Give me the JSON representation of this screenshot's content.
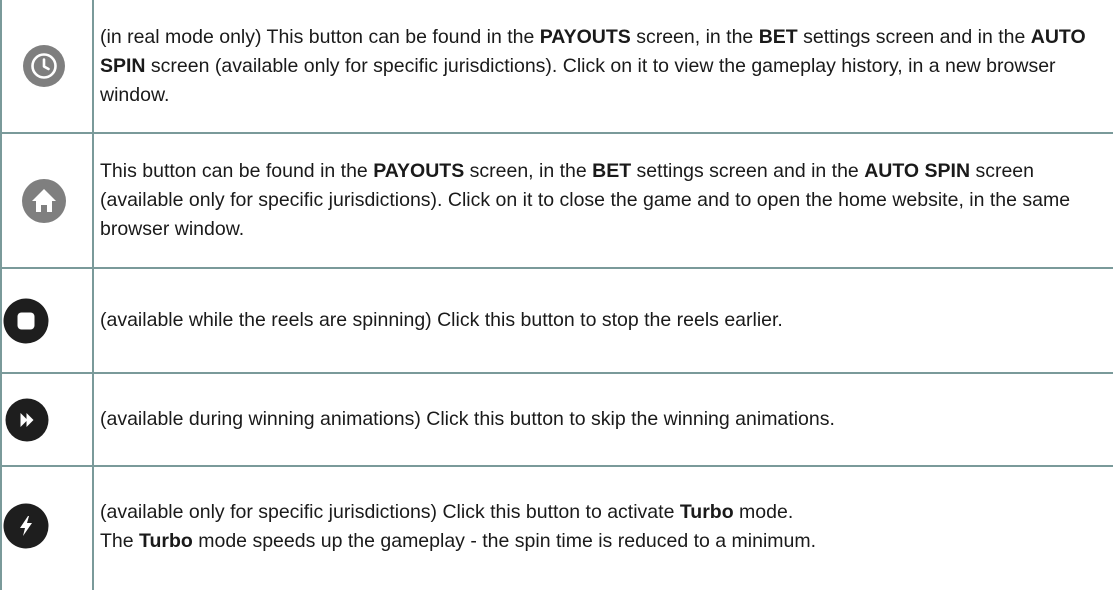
{
  "rows": [
    {
      "icon": "history-clock-icon",
      "parts": [
        {
          "t": "(in real mode only) This button can be found in the ",
          "b": false
        },
        {
          "t": "PAYOUTS",
          "b": true
        },
        {
          "t": " screen, in the ",
          "b": false
        },
        {
          "t": "BET",
          "b": true
        },
        {
          "t": " settings screen and in the ",
          "b": false
        },
        {
          "t": "AUTO SPIN",
          "b": true
        },
        {
          "t": " screen (available only for specific jurisdictions). Click on it to view the gameplay history, in a new browser window.",
          "b": false
        }
      ]
    },
    {
      "icon": "home-icon",
      "parts": [
        {
          "t": "This button can be found in the ",
          "b": false
        },
        {
          "t": "PAYOUTS",
          "b": true
        },
        {
          "t": " screen, in the ",
          "b": false
        },
        {
          "t": "BET",
          "b": true
        },
        {
          "t": " settings screen and in the ",
          "b": false
        },
        {
          "t": "AUTO SPIN",
          "b": true
        },
        {
          "t": " screen (available only for specific jurisdictions). Click on it to close the game and to open the home website, in the same browser window.",
          "b": false
        }
      ]
    },
    {
      "icon": "stop-icon",
      "parts": [
        {
          "t": "(available while the reels are spinning) Click this button to stop the reels earlier.",
          "b": false
        }
      ]
    },
    {
      "icon": "skip-icon",
      "parts": [
        {
          "t": "(available during winning animations) Click this button to skip the winning animations.",
          "b": false
        }
      ]
    },
    {
      "icon": "turbo-lightning-icon",
      "parts": [
        {
          "t": "(available only for specific jurisdictions) Click this button to activate ",
          "b": false
        },
        {
          "t": "Turbo",
          "b": true
        },
        {
          "t": " mode.",
          "b": false
        },
        {
          "t": "\n",
          "b": false
        },
        {
          "t": "The ",
          "b": false
        },
        {
          "t": "Turbo",
          "b": true
        },
        {
          "t": " mode speeds up the gameplay - the spin time is reduced to a minimum.",
          "b": false
        }
      ]
    }
  ],
  "colors": {
    "grid": "#7a9a9a",
    "grey_button": "#7f7f7f",
    "dark_button": "#1e1e1e"
  }
}
